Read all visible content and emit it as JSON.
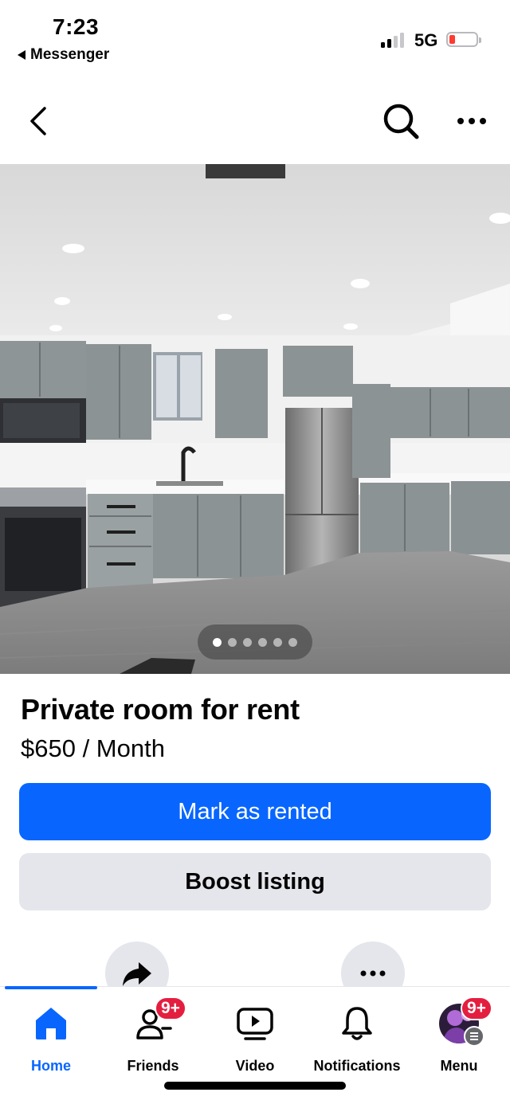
{
  "status_bar": {
    "time": "7:23",
    "back_app": "Messenger",
    "network": "5G",
    "signal_bars": 2,
    "battery_level": "low",
    "battery_color": "#ff3b30"
  },
  "nav": {
    "back_icon": "chevron-left-icon",
    "search_icon": "search-icon",
    "more_icon": "more-horizontal-icon"
  },
  "photo": {
    "subject": "kitchen-photo",
    "total_images": 6,
    "current_index": 1
  },
  "listing": {
    "title": "Private room for rent",
    "price": "$650 / Month"
  },
  "actions": {
    "primary_label": "Mark as rented",
    "secondary_label": "Boost listing",
    "share_icon": "share-icon",
    "more_icon": "more-horizontal-icon"
  },
  "tab_bar": {
    "tabs": [
      {
        "label": "Home",
        "icon": "home-icon",
        "active": true
      },
      {
        "label": "Friends",
        "icon": "friends-icon",
        "badge": "9+"
      },
      {
        "label": "Video",
        "icon": "video-icon"
      },
      {
        "label": "Notifications",
        "icon": "bell-icon"
      },
      {
        "label": "Menu",
        "icon": "avatar",
        "badge": "9+"
      }
    ]
  },
  "colors": {
    "accent": "#0866ff",
    "secondary_button": "#e4e6eb",
    "badge": "#e41e3f"
  }
}
